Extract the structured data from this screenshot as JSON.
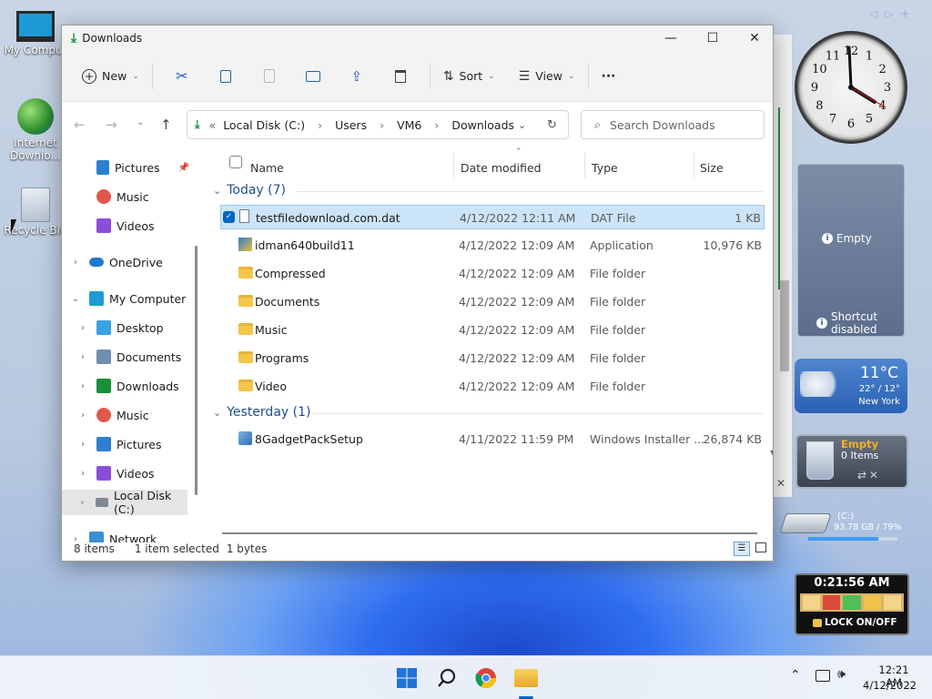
{
  "desktop": {
    "icons": [
      {
        "label": "My Comput"
      },
      {
        "label": "Internet Downlo..."
      },
      {
        "label": "Recycle Bin"
      }
    ],
    "top_arrows": [
      "◁",
      "▷",
      "+"
    ]
  },
  "window": {
    "title": "Downloads",
    "controls": {
      "minimize": "—",
      "maximize": "☐",
      "close": "✕"
    },
    "toolbar": {
      "new_label": "New",
      "sort_label": "Sort",
      "view_label": "View",
      "more_label": "···"
    },
    "address": {
      "prefix": "«",
      "crumbs": [
        "Local Disk (C:)",
        "Users",
        "VM6",
        "Downloads"
      ]
    },
    "search_placeholder": "Search Downloads",
    "nav": {
      "items": [
        {
          "label": "Pictures",
          "pinned": true
        },
        {
          "label": "Music"
        },
        {
          "label": "Videos"
        },
        {
          "label": "OneDrive"
        },
        {
          "label": "My Computer"
        },
        {
          "label": "Desktop"
        },
        {
          "label": "Documents"
        },
        {
          "label": "Downloads"
        },
        {
          "label": "Music"
        },
        {
          "label": "Pictures"
        },
        {
          "label": "Videos"
        },
        {
          "label": "Local Disk (C:)"
        },
        {
          "label": "Network"
        }
      ]
    },
    "columns": {
      "name": "Name",
      "date": "Date modified",
      "type": "Type",
      "size": "Size"
    },
    "groups": [
      {
        "label": "Today (7)",
        "rows": [
          {
            "name": "testfiledownload.com.dat",
            "date": "4/12/2022 12:11 AM",
            "type": "DAT File",
            "size": "1 KB",
            "selected": true
          },
          {
            "name": "idman640build11",
            "date": "4/12/2022 12:09 AM",
            "type": "Application",
            "size": "10,976 KB"
          },
          {
            "name": "Compressed",
            "date": "4/12/2022 12:09 AM",
            "type": "File folder",
            "size": ""
          },
          {
            "name": "Documents",
            "date": "4/12/2022 12:09 AM",
            "type": "File folder",
            "size": ""
          },
          {
            "name": "Music",
            "date": "4/12/2022 12:09 AM",
            "type": "File folder",
            "size": ""
          },
          {
            "name": "Programs",
            "date": "4/12/2022 12:09 AM",
            "type": "File folder",
            "size": ""
          },
          {
            "name": "Video",
            "date": "4/12/2022 12:09 AM",
            "type": "File folder",
            "size": ""
          }
        ]
      },
      {
        "label": "Yesterday (1)",
        "rows": [
          {
            "name": "8GadgetPackSetup",
            "date": "4/11/2022 11:59 PM",
            "type": "Windows Installer ...",
            "size": "26,874 KB"
          }
        ]
      }
    ],
    "status": {
      "items": "8 items",
      "selected": "1 item selected",
      "size": "1 bytes"
    }
  },
  "gadgets": {
    "clock_numbers": [
      "12",
      "1",
      "2",
      "3",
      "4",
      "5",
      "6",
      "7",
      "8",
      "9",
      "10",
      "11"
    ],
    "slideshow": {
      "empty": "Empty",
      "shortcut": "Shortcut disabled"
    },
    "weather": {
      "temp": "11°C",
      "range": "22° / 12°",
      "city": "New York"
    },
    "recycle": {
      "state": "Empty",
      "items": "0 Items"
    },
    "drive": {
      "label": "(C:)",
      "usage": "93.78 GB / 79%",
      "fill": 0.79
    },
    "timer": {
      "time": "0:21:56 AM",
      "lock": "LOCK ON/OFF"
    }
  },
  "taskbar": {
    "time": "12:21 AM",
    "date": "4/12/2022"
  },
  "colors": {
    "accent": "#0067c0",
    "selection": "#cce4f7",
    "folder": "#f4c64a"
  }
}
